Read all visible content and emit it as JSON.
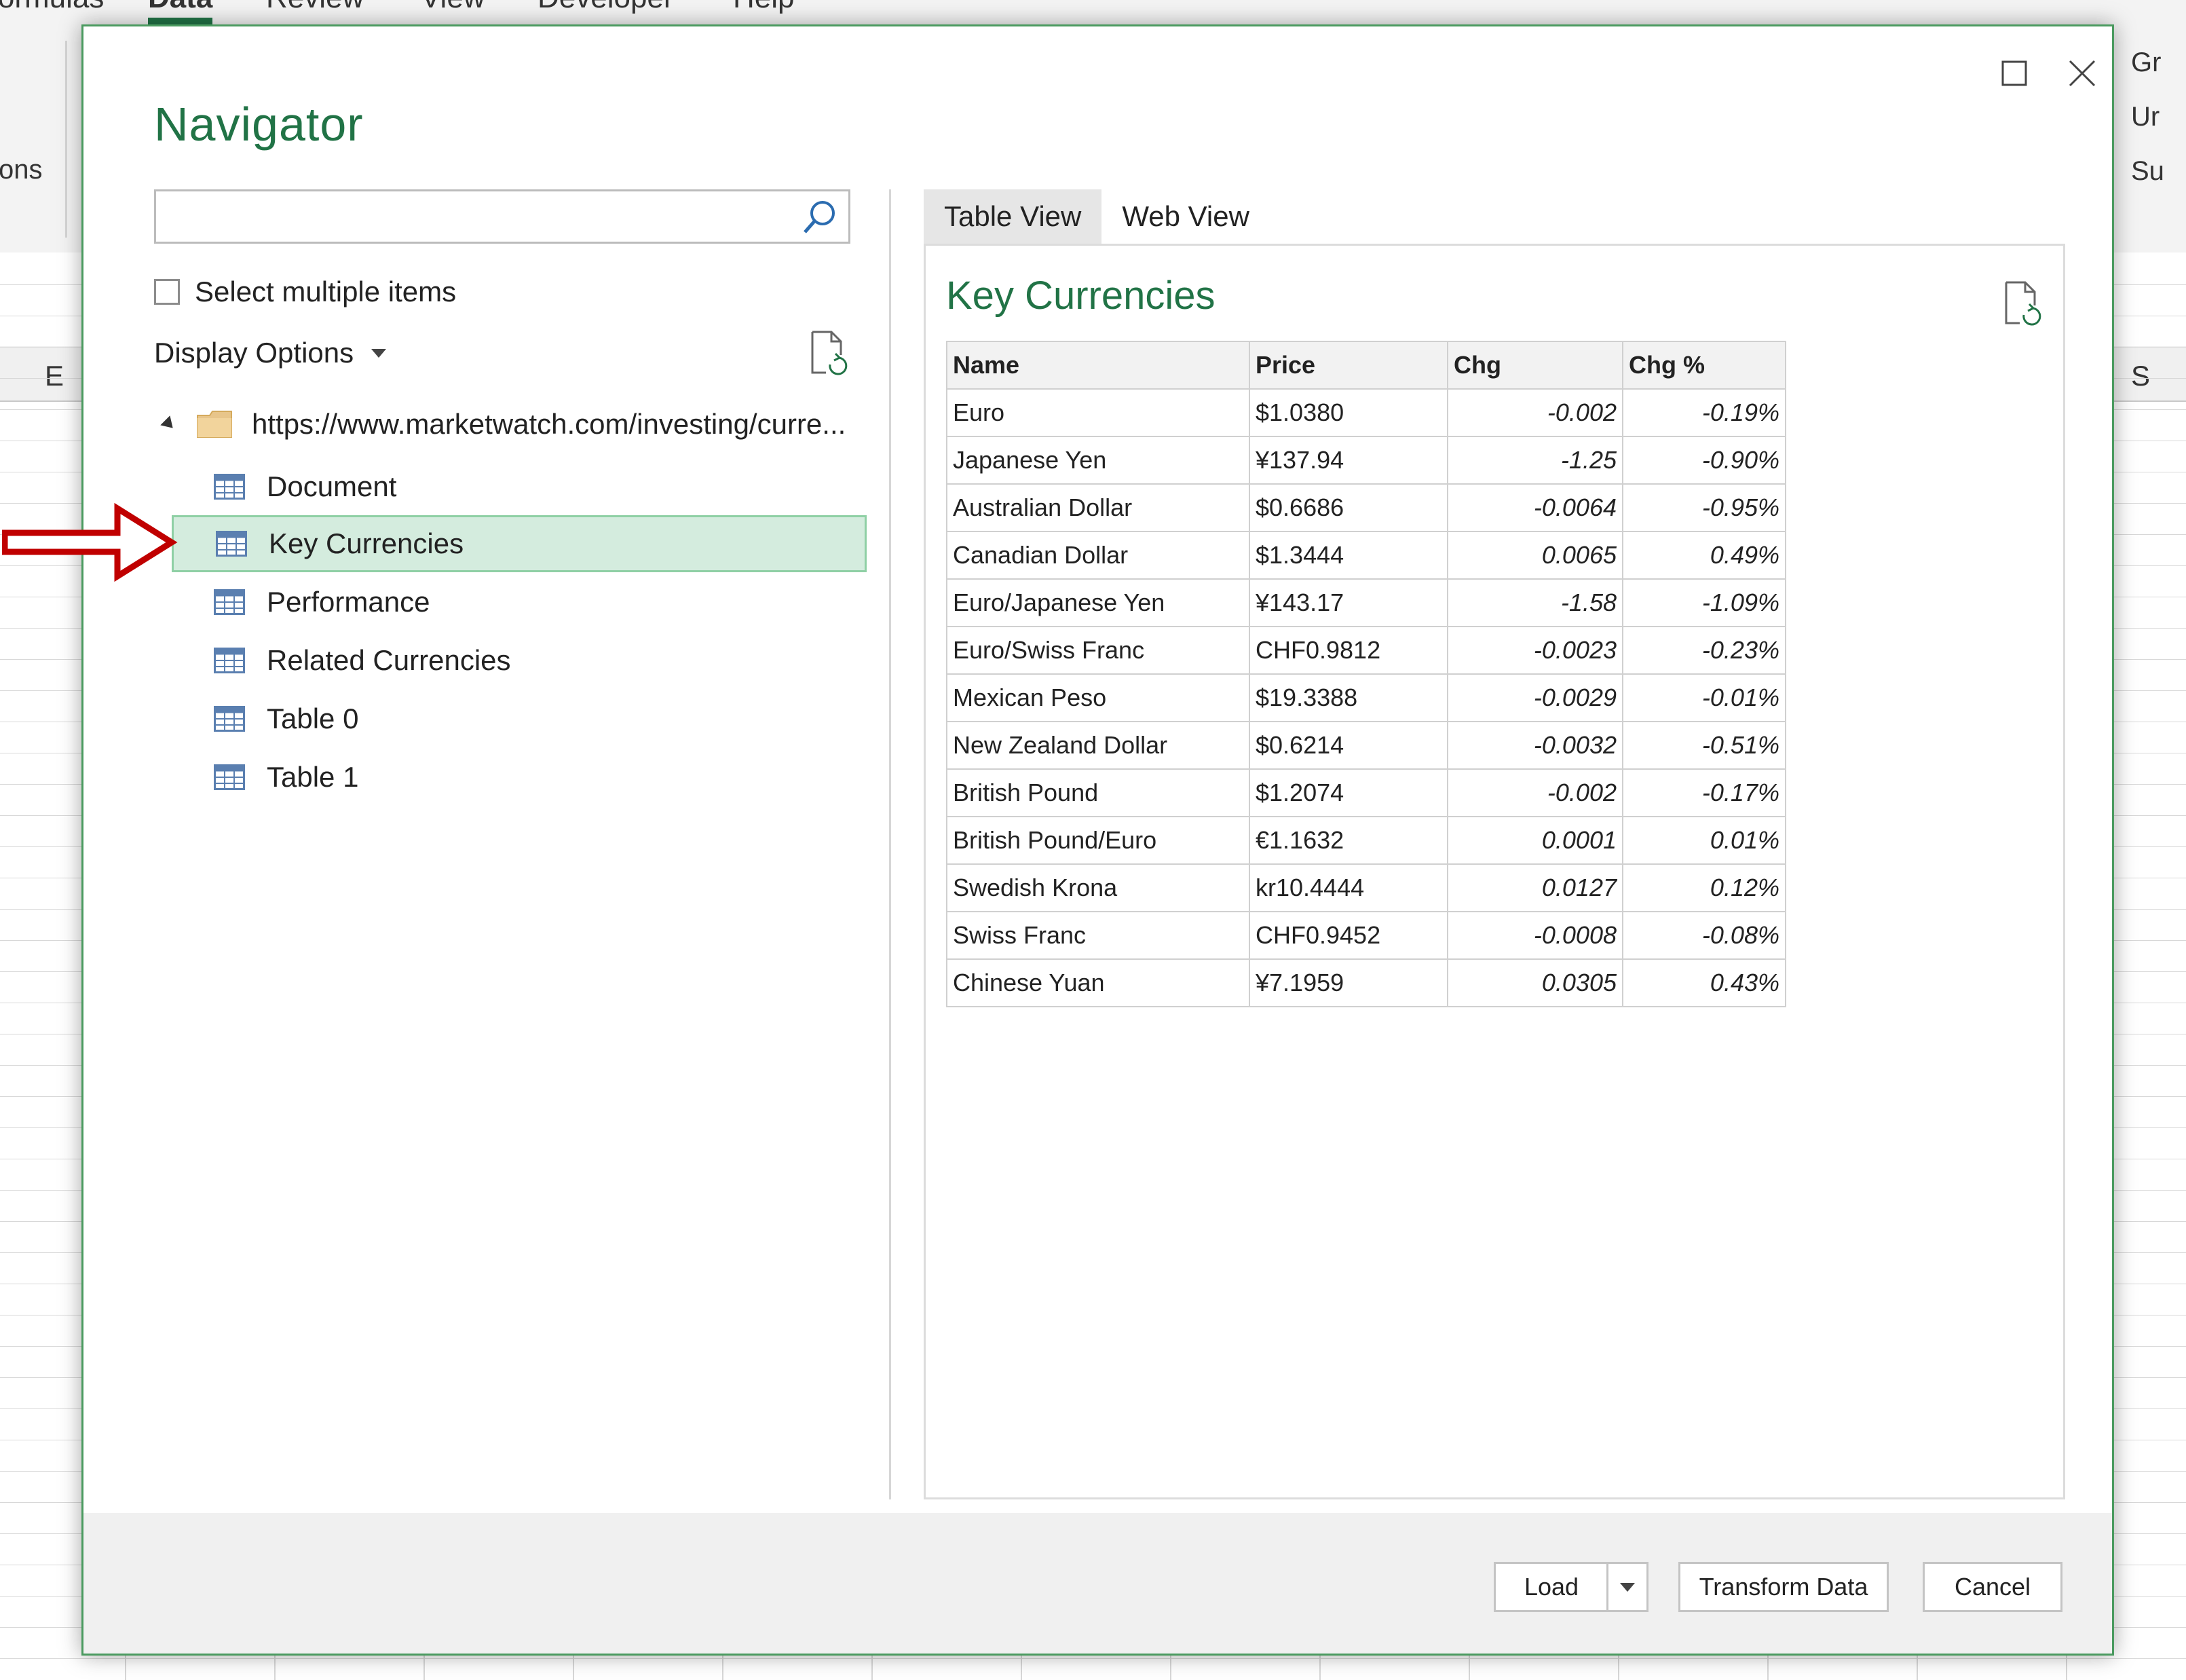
{
  "excel": {
    "tabs": [
      "Formulas",
      "Data",
      "Review",
      "View",
      "Developer",
      "Help"
    ],
    "active_tab": "Data",
    "ribbon_left_fragment": "ons",
    "ribbon_right_items": [
      "Gr",
      "Ur",
      "Su"
    ],
    "column_headers": [
      "E",
      "S"
    ]
  },
  "dialog": {
    "title": "Navigator",
    "search": {
      "value": "",
      "placeholder": ""
    },
    "select_multiple_label": "Select multiple items",
    "display_options_label": "Display Options",
    "tree": {
      "root_label": "https://www.marketwatch.com/investing/curre...",
      "items": [
        {
          "label": "Document"
        },
        {
          "label": "Key Currencies",
          "selected": true
        },
        {
          "label": "Performance"
        },
        {
          "label": "Related Currencies"
        },
        {
          "label": "Table 0"
        },
        {
          "label": "Table 1"
        }
      ]
    },
    "tabs": [
      "Table View",
      "Web View"
    ],
    "active_tab": "Table View",
    "preview": {
      "title": "Key Currencies",
      "columns": [
        "Name",
        "Price",
        "Chg",
        "Chg %"
      ],
      "rows": [
        [
          "Euro",
          "$1.0380",
          "-0.002",
          "-0.19%"
        ],
        [
          "Japanese Yen",
          "¥137.94",
          "-1.25",
          "-0.90%"
        ],
        [
          "Australian Dollar",
          "$0.6686",
          "-0.0064",
          "-0.95%"
        ],
        [
          "Canadian Dollar",
          "$1.3444",
          "0.0065",
          "0.49%"
        ],
        [
          "Euro/Japanese Yen",
          "¥143.17",
          "-1.58",
          "-1.09%"
        ],
        [
          "Euro/Swiss Franc",
          "CHF0.9812",
          "-0.0023",
          "-0.23%"
        ],
        [
          "Mexican Peso",
          "$19.3388",
          "-0.0029",
          "-0.01%"
        ],
        [
          "New Zealand Dollar",
          "$0.6214",
          "-0.0032",
          "-0.51%"
        ],
        [
          "British Pound",
          "$1.2074",
          "-0.002",
          "-0.17%"
        ],
        [
          "British Pound/Euro",
          "€1.1632",
          "0.0001",
          "0.01%"
        ],
        [
          "Swedish Krona",
          "kr10.4444",
          "0.0127",
          "0.12%"
        ],
        [
          "Swiss Franc",
          "CHF0.9452",
          "-0.0008",
          "-0.08%"
        ],
        [
          "Chinese Yuan",
          "¥7.1959",
          "0.0305",
          "0.43%"
        ]
      ]
    },
    "buttons": {
      "load": "Load",
      "transform": "Transform Data",
      "cancel": "Cancel"
    }
  },
  "icons": {
    "maximize": "maximize-icon",
    "close": "close-icon",
    "search": "search-icon",
    "refresh": "refresh-icon",
    "table": "table-icon",
    "folder": "folder-icon",
    "arrow": "red-arrow-icon"
  },
  "colors": {
    "accent": "#217346",
    "selection_fill": "#d4ecde",
    "selection_border": "#8fd0a5",
    "arrow": "#c00000"
  }
}
